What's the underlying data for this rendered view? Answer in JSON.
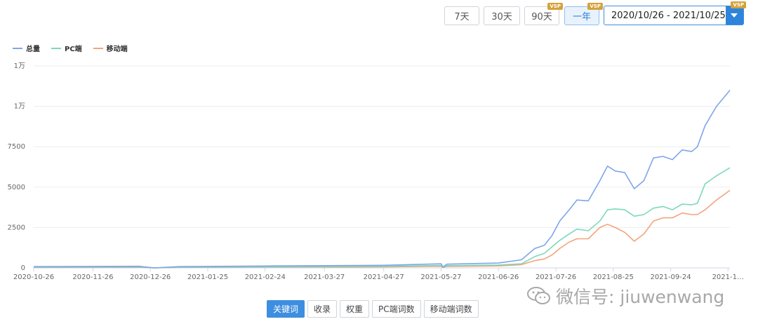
{
  "range_buttons": [
    {
      "label": "7天",
      "vip": false,
      "active": false
    },
    {
      "label": "30天",
      "vip": false,
      "active": false
    },
    {
      "label": "90天",
      "vip": true,
      "active": false
    },
    {
      "label": "一年",
      "vip": true,
      "active": true
    }
  ],
  "vip_badge": "VSP",
  "date_range": "2020/10/26 - 2021/10/25",
  "tabs": [
    "关键词",
    "收录",
    "权重",
    "PC端词数",
    "移动端词数"
  ],
  "watermark": "微信号: jiuwenwang",
  "chart_data": {
    "type": "line",
    "title": "",
    "xlabel": "",
    "ylabel": "",
    "ylim": [
      0,
      12500
    ],
    "y_ticks": [
      {
        "value": 0,
        "label": "0"
      },
      {
        "value": 2500,
        "label": "2500"
      },
      {
        "value": 5000,
        "label": "5000"
      },
      {
        "value": 7500,
        "label": "7500"
      },
      {
        "value": 10000,
        "label": "1万"
      },
      {
        "value": 12500,
        "label": "1万"
      }
    ],
    "x_ticks": [
      "2020-10-26",
      "2020-11-26",
      "2020-12-26",
      "2021-01-25",
      "2021-02-24",
      "2021-03-27",
      "2021-04-27",
      "2021-05-27",
      "2021-06-26",
      "2021-07-26",
      "2021-08-25",
      "2021-09-24",
      "2021-1…"
    ],
    "grid": true,
    "legend_position": "top-left",
    "series": [
      {
        "name": "总量",
        "color": "#7ea6ea",
        "points": [
          [
            "2020-10-26",
            80
          ],
          [
            "2020-12-20",
            100
          ],
          [
            "2020-12-28",
            0
          ],
          [
            "2021-01-10",
            80
          ],
          [
            "2021-03-01",
            120
          ],
          [
            "2021-04-27",
            160
          ],
          [
            "2021-05-27",
            250
          ],
          [
            "2021-05-28",
            50
          ],
          [
            "2021-05-30",
            230
          ],
          [
            "2021-06-26",
            300
          ],
          [
            "2021-07-08",
            500
          ],
          [
            "2021-07-15",
            1200
          ],
          [
            "2021-07-20",
            1400
          ],
          [
            "2021-07-24",
            2000
          ],
          [
            "2021-07-28",
            2900
          ],
          [
            "2021-08-02",
            3600
          ],
          [
            "2021-08-06",
            4200
          ],
          [
            "2021-08-12",
            4150
          ],
          [
            "2021-08-18",
            5400
          ],
          [
            "2021-08-22",
            6300
          ],
          [
            "2021-08-26",
            6000
          ],
          [
            "2021-08-31",
            5900
          ],
          [
            "2021-09-05",
            4900
          ],
          [
            "2021-09-10",
            5400
          ],
          [
            "2021-09-15",
            6800
          ],
          [
            "2021-09-20",
            6900
          ],
          [
            "2021-09-25",
            6700
          ],
          [
            "2021-09-30",
            7300
          ],
          [
            "2021-10-05",
            7200
          ],
          [
            "2021-10-08",
            7500
          ],
          [
            "2021-10-12",
            8800
          ],
          [
            "2021-10-18",
            10000
          ],
          [
            "2021-10-25",
            11000
          ]
        ]
      },
      {
        "name": "PC端",
        "color": "#7dd9b8",
        "points": [
          [
            "2020-10-26",
            40
          ],
          [
            "2020-12-20",
            60
          ],
          [
            "2020-12-28",
            0
          ],
          [
            "2021-01-10",
            40
          ],
          [
            "2021-03-01",
            70
          ],
          [
            "2021-04-27",
            100
          ],
          [
            "2021-05-27",
            150
          ],
          [
            "2021-05-28",
            30
          ],
          [
            "2021-05-30",
            140
          ],
          [
            "2021-06-26",
            180
          ],
          [
            "2021-07-08",
            250
          ],
          [
            "2021-07-15",
            700
          ],
          [
            "2021-07-20",
            900
          ],
          [
            "2021-07-24",
            1300
          ],
          [
            "2021-07-28",
            1700
          ],
          [
            "2021-08-02",
            2100
          ],
          [
            "2021-08-06",
            2400
          ],
          [
            "2021-08-12",
            2300
          ],
          [
            "2021-08-18",
            2900
          ],
          [
            "2021-08-22",
            3600
          ],
          [
            "2021-08-26",
            3650
          ],
          [
            "2021-08-31",
            3600
          ],
          [
            "2021-09-05",
            3200
          ],
          [
            "2021-09-10",
            3300
          ],
          [
            "2021-09-15",
            3700
          ],
          [
            "2021-09-20",
            3800
          ],
          [
            "2021-09-25",
            3600
          ],
          [
            "2021-09-30",
            3950
          ],
          [
            "2021-10-05",
            3900
          ],
          [
            "2021-10-08",
            4000
          ],
          [
            "2021-10-12",
            5200
          ],
          [
            "2021-10-18",
            5700
          ],
          [
            "2021-10-25",
            6200
          ]
        ]
      },
      {
        "name": "移动端",
        "color": "#f3a47c",
        "points": [
          [
            "2020-10-26",
            20
          ],
          [
            "2020-12-20",
            40
          ],
          [
            "2020-12-28",
            0
          ],
          [
            "2021-01-10",
            30
          ],
          [
            "2021-03-01",
            50
          ],
          [
            "2021-04-27",
            60
          ],
          [
            "2021-05-27",
            100
          ],
          [
            "2021-05-28",
            20
          ],
          [
            "2021-05-30",
            90
          ],
          [
            "2021-06-26",
            120
          ],
          [
            "2021-07-08",
            200
          ],
          [
            "2021-07-15",
            450
          ],
          [
            "2021-07-20",
            550
          ],
          [
            "2021-07-24",
            800
          ],
          [
            "2021-07-28",
            1200
          ],
          [
            "2021-08-02",
            1600
          ],
          [
            "2021-08-06",
            1800
          ],
          [
            "2021-08-12",
            1800
          ],
          [
            "2021-08-18",
            2500
          ],
          [
            "2021-08-22",
            2700
          ],
          [
            "2021-08-26",
            2500
          ],
          [
            "2021-08-31",
            2200
          ],
          [
            "2021-09-05",
            1650
          ],
          [
            "2021-09-10",
            2100
          ],
          [
            "2021-09-15",
            2900
          ],
          [
            "2021-09-20",
            3100
          ],
          [
            "2021-09-25",
            3100
          ],
          [
            "2021-09-30",
            3400
          ],
          [
            "2021-10-05",
            3300
          ],
          [
            "2021-10-08",
            3300
          ],
          [
            "2021-10-12",
            3600
          ],
          [
            "2021-10-18",
            4200
          ],
          [
            "2021-10-25",
            4800
          ]
        ]
      }
    ]
  }
}
